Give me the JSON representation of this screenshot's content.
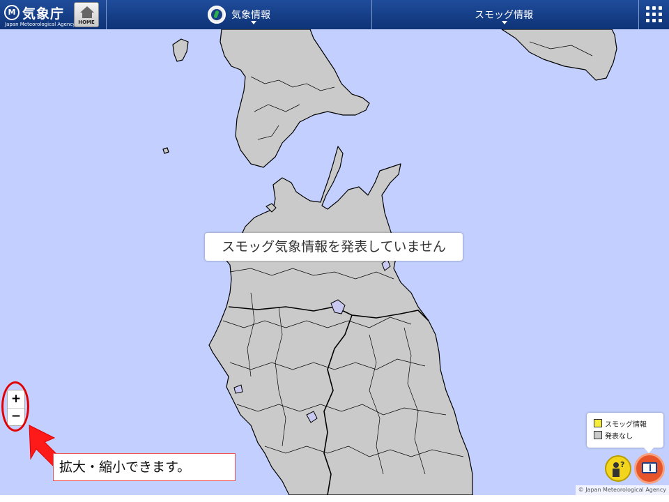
{
  "header": {
    "logo_title": "気象庁",
    "logo_subtitle": "Japan Meteorological Agency",
    "logo_mark": "M",
    "home_label": "HOME",
    "menu_weather": "気象情報",
    "menu_smog": "スモッグ情報"
  },
  "map": {
    "notice": "スモッグ気象情報を発表していません",
    "attribution": "© Japan Meteorological Agency",
    "colors": {
      "sea": "#c3d0ff",
      "land": "#cacaca",
      "highlight": "#c8c8f0",
      "border": "#000000"
    }
  },
  "zoom": {
    "in": "+",
    "out": "−"
  },
  "callout": {
    "text": "拡大・縮小できます。"
  },
  "legend": {
    "items": [
      {
        "label": "スモッグ情報",
        "color": "#f5ec3c"
      },
      {
        "label": "発表なし",
        "color": "#cacaca"
      }
    ]
  },
  "icons": {
    "help": "help-person-icon",
    "info": "info-book-icon",
    "menu": "grid-menu-icon"
  }
}
